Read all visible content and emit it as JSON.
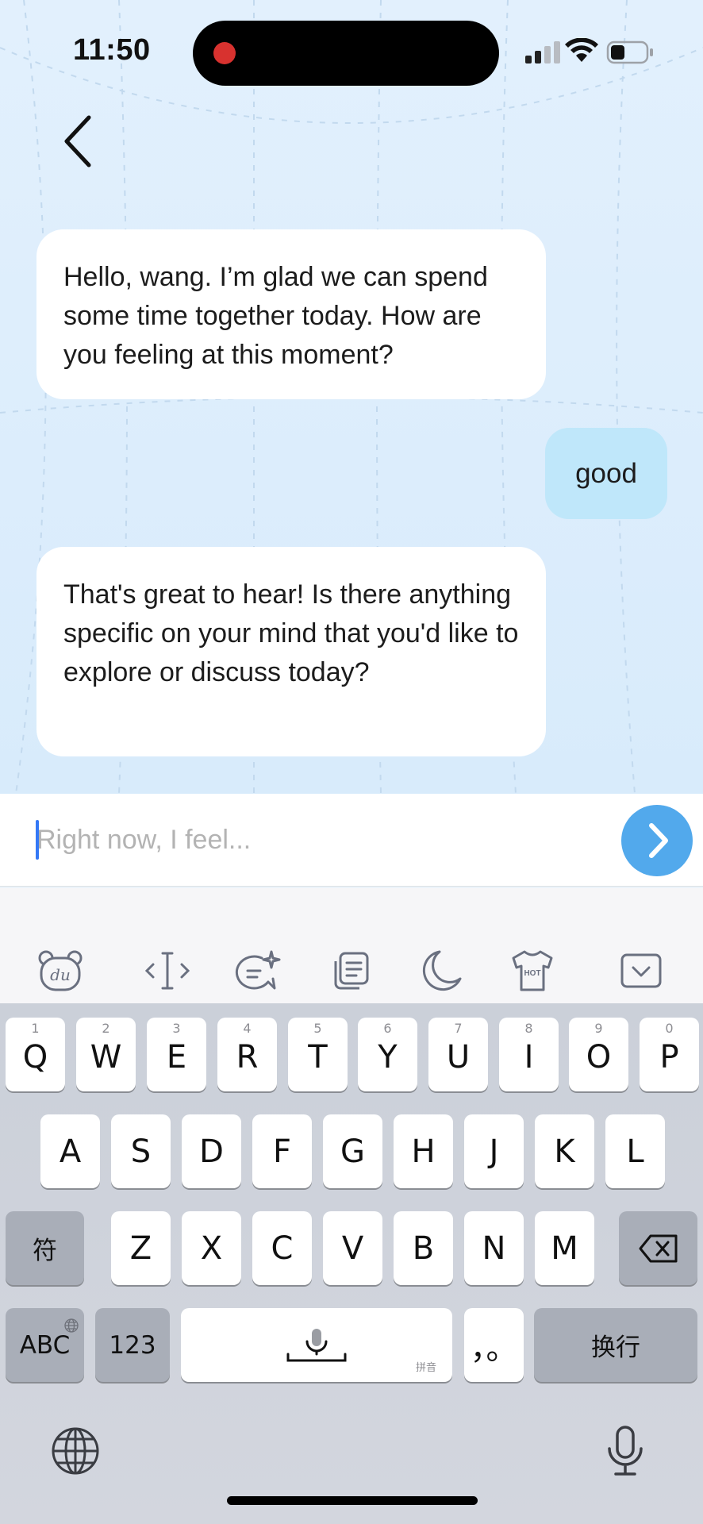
{
  "status_bar": {
    "time": "11:50"
  },
  "chat": {
    "messages": [
      {
        "role": "assistant",
        "text": "Hello, wang. I’m glad we can spend some time together today. How are you feeling at this moment?"
      },
      {
        "role": "user",
        "text": "good"
      },
      {
        "role": "assistant",
        "text": "That's great to hear! Is there anything specific on your mind that you'd like to explore or discuss today?"
      }
    ]
  },
  "input": {
    "placeholder": "Right now, I feel...",
    "value": ""
  },
  "keyboard": {
    "row1": [
      {
        "num": "1",
        "letter": "Q"
      },
      {
        "num": "2",
        "letter": "W"
      },
      {
        "num": "3",
        "letter": "E"
      },
      {
        "num": "4",
        "letter": "R"
      },
      {
        "num": "5",
        "letter": "T"
      },
      {
        "num": "6",
        "letter": "Y"
      },
      {
        "num": "7",
        "letter": "U"
      },
      {
        "num": "8",
        "letter": "I"
      },
      {
        "num": "9",
        "letter": "O"
      },
      {
        "num": "0",
        "letter": "P"
      }
    ],
    "row2": [
      "A",
      "S",
      "D",
      "F",
      "G",
      "H",
      "J",
      "K",
      "L"
    ],
    "row3_left": "符",
    "row3": [
      "Z",
      "X",
      "C",
      "V",
      "B",
      "N",
      "M"
    ],
    "abc_label": "ABC",
    "num_label": "123",
    "space_tag": "拼音",
    "punct_label": "，。",
    "return_label": "换行",
    "toolbar_hot": "HOT"
  },
  "colors": {
    "send": "#52a9ec",
    "user_bubble": "#bfe7fa",
    "recording": "#d8322f"
  }
}
